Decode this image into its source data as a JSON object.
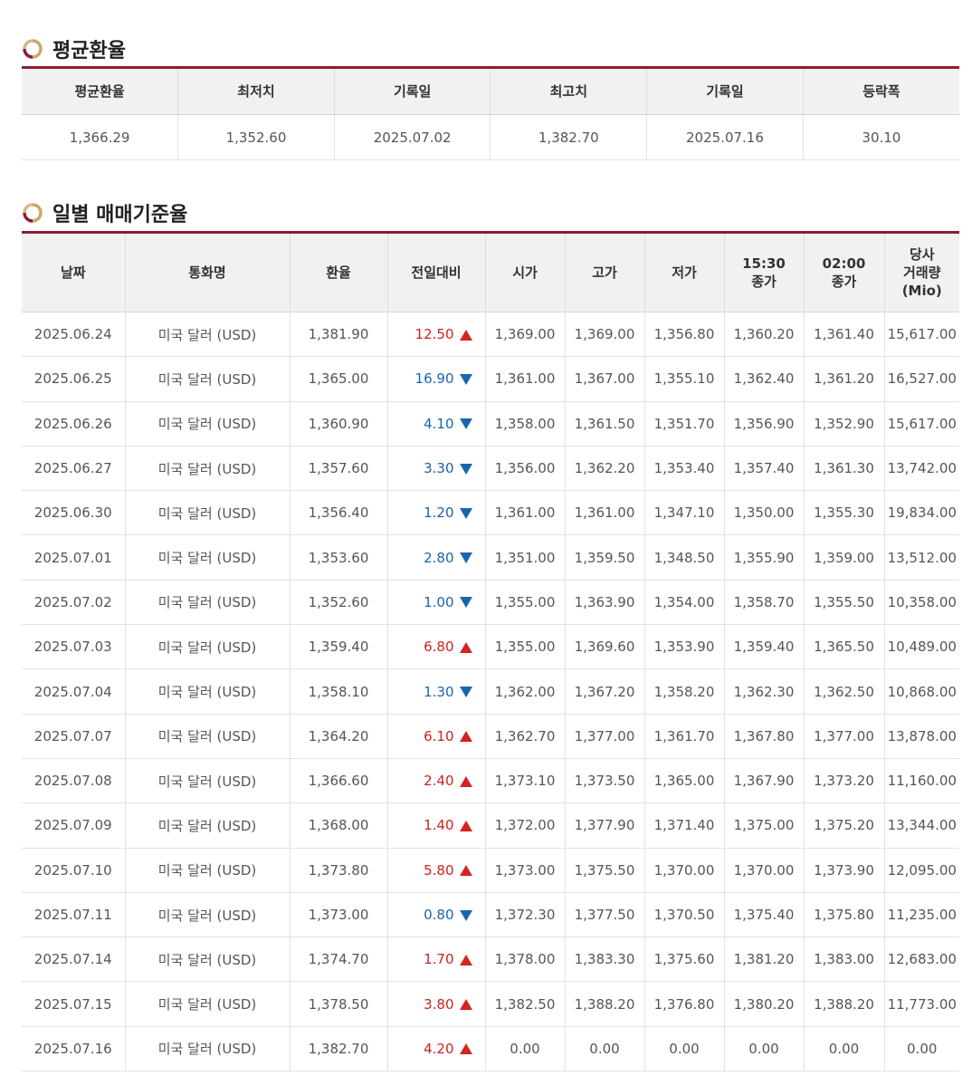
{
  "summary_section": {
    "title": "평균환율",
    "headers": [
      "평균환율",
      "최저치",
      "기록일",
      "최고치",
      "기록일",
      "등락폭"
    ],
    "values": [
      "1,366.29",
      "1,352.60",
      "2025.07.02",
      "1,382.70",
      "2025.07.16",
      "30.10"
    ]
  },
  "daily_section": {
    "title": "일별 매매기준율",
    "headers": [
      "날짜",
      "통화명",
      "환율",
      "전일대비",
      "시가",
      "고가",
      "저가",
      "15:30\n종가",
      "02:00\n종가",
      "당사\n거래량\n(Mio)"
    ],
    "rows": [
      {
        "date": "2025.06.24",
        "currency": "미국 달러 (USD)",
        "rate": "1,381.90",
        "change": "12.50",
        "dir": "up",
        "open": "1,369.00",
        "high": "1,369.00",
        "low": "1,356.80",
        "close1530": "1,360.20",
        "close0200": "1,361.40",
        "volume": "15,617.00"
      },
      {
        "date": "2025.06.25",
        "currency": "미국 달러 (USD)",
        "rate": "1,365.00",
        "change": "16.90",
        "dir": "down",
        "open": "1,361.00",
        "high": "1,367.00",
        "low": "1,355.10",
        "close1530": "1,362.40",
        "close0200": "1,361.20",
        "volume": "16,527.00"
      },
      {
        "date": "2025.06.26",
        "currency": "미국 달러 (USD)",
        "rate": "1,360.90",
        "change": "4.10",
        "dir": "down",
        "open": "1,358.00",
        "high": "1,361.50",
        "low": "1,351.70",
        "close1530": "1,356.90",
        "close0200": "1,352.90",
        "volume": "15,617.00"
      },
      {
        "date": "2025.06.27",
        "currency": "미국 달러 (USD)",
        "rate": "1,357.60",
        "change": "3.30",
        "dir": "down",
        "open": "1,356.00",
        "high": "1,362.20",
        "low": "1,353.40",
        "close1530": "1,357.40",
        "close0200": "1,361.30",
        "volume": "13,742.00"
      },
      {
        "date": "2025.06.30",
        "currency": "미국 달러 (USD)",
        "rate": "1,356.40",
        "change": "1.20",
        "dir": "down",
        "open": "1,361.00",
        "high": "1,361.00",
        "low": "1,347.10",
        "close1530": "1,350.00",
        "close0200": "1,355.30",
        "volume": "19,834.00"
      },
      {
        "date": "2025.07.01",
        "currency": "미국 달러 (USD)",
        "rate": "1,353.60",
        "change": "2.80",
        "dir": "down",
        "open": "1,351.00",
        "high": "1,359.50",
        "low": "1,348.50",
        "close1530": "1,355.90",
        "close0200": "1,359.00",
        "volume": "13,512.00"
      },
      {
        "date": "2025.07.02",
        "currency": "미국 달러 (USD)",
        "rate": "1,352.60",
        "change": "1.00",
        "dir": "down",
        "open": "1,355.00",
        "high": "1,363.90",
        "low": "1,354.00",
        "close1530": "1,358.70",
        "close0200": "1,355.50",
        "volume": "10,358.00"
      },
      {
        "date": "2025.07.03",
        "currency": "미국 달러 (USD)",
        "rate": "1,359.40",
        "change": "6.80",
        "dir": "up",
        "open": "1,355.00",
        "high": "1,369.60",
        "low": "1,353.90",
        "close1530": "1,359.40",
        "close0200": "1,365.50",
        "volume": "10,489.00"
      },
      {
        "date": "2025.07.04",
        "currency": "미국 달러 (USD)",
        "rate": "1,358.10",
        "change": "1.30",
        "dir": "down",
        "open": "1,362.00",
        "high": "1,367.20",
        "low": "1,358.20",
        "close1530": "1,362.30",
        "close0200": "1,362.50",
        "volume": "10,868.00"
      },
      {
        "date": "2025.07.07",
        "currency": "미국 달러 (USD)",
        "rate": "1,364.20",
        "change": "6.10",
        "dir": "up",
        "open": "1,362.70",
        "high": "1,377.00",
        "low": "1,361.70",
        "close1530": "1,367.80",
        "close0200": "1,377.00",
        "volume": "13,878.00"
      },
      {
        "date": "2025.07.08",
        "currency": "미국 달러 (USD)",
        "rate": "1,366.60",
        "change": "2.40",
        "dir": "up",
        "open": "1,373.10",
        "high": "1,373.50",
        "low": "1,365.00",
        "close1530": "1,367.90",
        "close0200": "1,373.20",
        "volume": "11,160.00"
      },
      {
        "date": "2025.07.09",
        "currency": "미국 달러 (USD)",
        "rate": "1,368.00",
        "change": "1.40",
        "dir": "up",
        "open": "1,372.00",
        "high": "1,377.90",
        "low": "1,371.40",
        "close1530": "1,375.00",
        "close0200": "1,375.20",
        "volume": "13,344.00"
      },
      {
        "date": "2025.07.10",
        "currency": "미국 달러 (USD)",
        "rate": "1,373.80",
        "change": "5.80",
        "dir": "up",
        "open": "1,373.00",
        "high": "1,375.50",
        "low": "1,370.00",
        "close1530": "1,370.00",
        "close0200": "1,373.90",
        "volume": "12,095.00"
      },
      {
        "date": "2025.07.11",
        "currency": "미국 달러 (USD)",
        "rate": "1,373.00",
        "change": "0.80",
        "dir": "down",
        "open": "1,372.30",
        "high": "1,377.50",
        "low": "1,370.50",
        "close1530": "1,375.40",
        "close0200": "1,375.80",
        "volume": "11,235.00"
      },
      {
        "date": "2025.07.14",
        "currency": "미국 달러 (USD)",
        "rate": "1,374.70",
        "change": "1.70",
        "dir": "up",
        "open": "1,378.00",
        "high": "1,383.30",
        "low": "1,375.60",
        "close1530": "1,381.20",
        "close0200": "1,383.00",
        "volume": "12,683.00"
      },
      {
        "date": "2025.07.15",
        "currency": "미국 달러 (USD)",
        "rate": "1,378.50",
        "change": "3.80",
        "dir": "up",
        "open": "1,382.50",
        "high": "1,388.20",
        "low": "1,376.80",
        "close1530": "1,380.20",
        "close0200": "1,388.20",
        "volume": "11,773.00"
      },
      {
        "date": "2025.07.16",
        "currency": "미국 달러 (USD)",
        "rate": "1,382.70",
        "change": "4.20",
        "dir": "up",
        "open": "0.00",
        "high": "0.00",
        "low": "0.00",
        "close1530": "0.00",
        "close0200": "0.00",
        "volume": "0.00"
      }
    ]
  },
  "icons": {
    "section_icon": "ring-icon",
    "up": "triangle-up-icon",
    "down": "triangle-down-icon"
  },
  "colors": {
    "accent": "#8c1d32",
    "up": "#cc2222",
    "down": "#1a64ad"
  }
}
